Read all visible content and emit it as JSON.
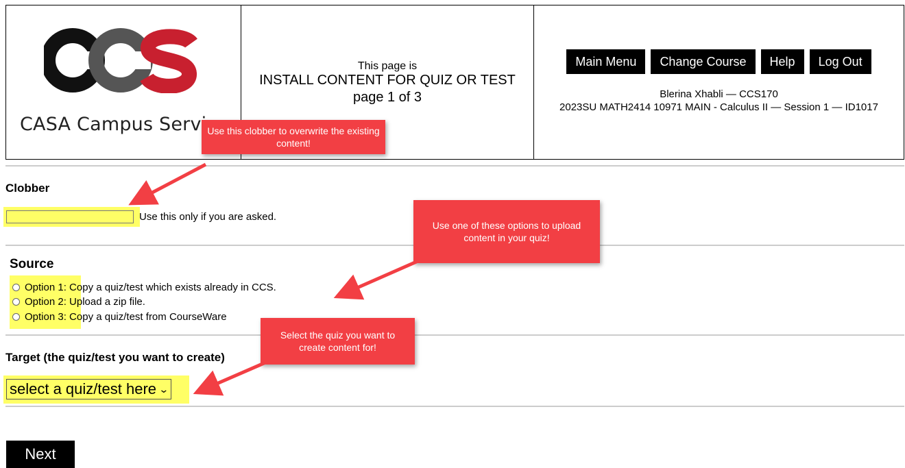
{
  "header": {
    "logo": {
      "mark_text": "CCS",
      "brand_name": "CASA Campus Servi"
    },
    "title": {
      "intro": "This page is",
      "heading": "INSTALL CONTENT FOR QUIZ OR TEST",
      "page_indicator": "page 1 of 3"
    },
    "nav": {
      "buttons": [
        "Main Menu",
        "Change Course",
        "Help",
        "Log Out"
      ]
    },
    "user": "Blerina Xhabli — CCS170",
    "course": "2023SU MATH2414 10971 MAIN - Calculus II — Session 1 — ID1017"
  },
  "clobber": {
    "heading": "Clobber",
    "input_value": "",
    "note": "Use this only if you are asked."
  },
  "source": {
    "heading": "Source",
    "options": [
      {
        "label": "Option 1:",
        "text": "Copy a quiz/test which exists already in CCS."
      },
      {
        "label": "Option 2:",
        "text": "Upload a zip file."
      },
      {
        "label": "Option 3:",
        "text": "Copy a quiz/test from CourseWare"
      }
    ]
  },
  "target": {
    "heading": "Target (the quiz/test you want to create)",
    "select_value": "select a quiz/test here"
  },
  "next_label": "Next",
  "callouts": {
    "clobber": "Use this clobber to overwrite the existing content!",
    "source": "Use one of these options to upload content in your quiz!",
    "target": "Select the quiz you want to create content for!"
  },
  "colors": {
    "callout": "#f23f44",
    "highlight": "#ffff66",
    "logo_dark": "#111111",
    "logo_gray": "#555555",
    "logo_red": "#c8202f"
  }
}
